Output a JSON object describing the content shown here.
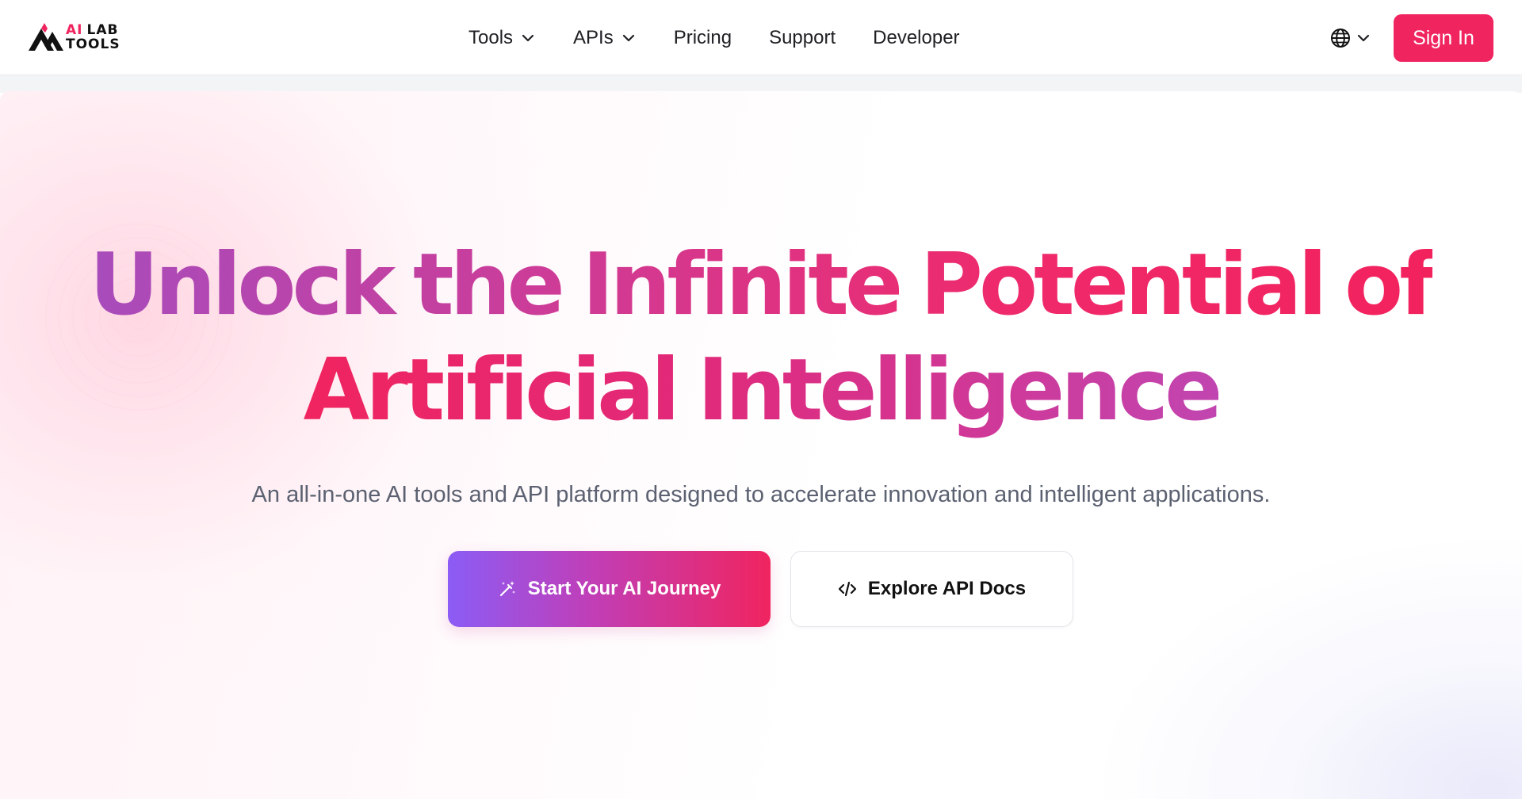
{
  "brand": {
    "logo_ai": "AI",
    "logo_lab": "LAB",
    "logo_tools": "TOOLS",
    "accent_color": "#f0245f"
  },
  "nav": {
    "items": [
      {
        "label": "Tools",
        "has_dropdown": true
      },
      {
        "label": "APIs",
        "has_dropdown": true
      },
      {
        "label": "Pricing",
        "has_dropdown": false
      },
      {
        "label": "Support",
        "has_dropdown": false
      },
      {
        "label": "Developer",
        "has_dropdown": false
      }
    ],
    "language_icon": "globe-icon",
    "signin_label": "Sign In"
  },
  "hero": {
    "headline_line1": "Unlock the Infinite Potential of",
    "headline_line2": "Artificial Intelligence",
    "subtitle": "An all-in-one AI tools and API platform designed to accelerate innovation and intelligent applications.",
    "primary_cta": {
      "label": "Start Your AI Journey",
      "icon": "magic-wand-icon"
    },
    "secondary_cta": {
      "label": "Explore API Docs",
      "icon": "code-icon"
    },
    "gradient_colors": [
      "#8b5cf6",
      "#c13eb6",
      "#f0245f"
    ]
  }
}
